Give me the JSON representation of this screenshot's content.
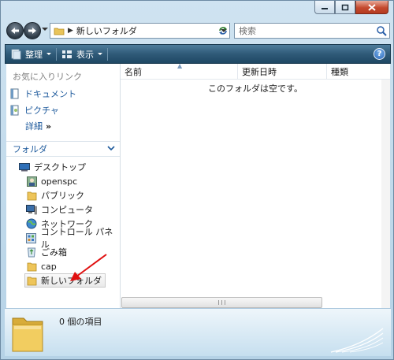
{
  "window": {
    "address_path": "新しいフォルダ",
    "search_placeholder": "検索"
  },
  "toolbar": {
    "organize_label": "整理",
    "views_label": "表示",
    "help_label": "?"
  },
  "nav": {
    "favorites_header": "お気に入りリンク",
    "favorites": [
      {
        "label": "ドキュメント",
        "icon": "documents-icon"
      },
      {
        "label": "ピクチャ",
        "icon": "pictures-icon"
      }
    ],
    "more_label": "詳細",
    "more_chevron": "»",
    "folders_header": "フォルダ",
    "tree": [
      {
        "label": "デスクトップ",
        "icon": "desktop-icon"
      },
      {
        "label": "openspc",
        "icon": "user-folder-icon"
      },
      {
        "label": "パブリック",
        "icon": "folder-icon"
      },
      {
        "label": "コンピュータ",
        "icon": "computer-icon"
      },
      {
        "label": "ネットワーク",
        "icon": "network-icon"
      },
      {
        "label": "コントロール パネル",
        "icon": "control-panel-icon"
      },
      {
        "label": "ごみ箱",
        "icon": "recycle-bin-icon"
      },
      {
        "label": "cap",
        "icon": "folder-icon"
      },
      {
        "label": "新しいフォルダ",
        "icon": "folder-icon",
        "selected": true
      }
    ]
  },
  "content": {
    "columns": [
      "名前",
      "更新日時",
      "種類"
    ],
    "empty_message": "このフォルダは空です。"
  },
  "details": {
    "item_count": "0 個の項目"
  },
  "colors": {
    "toolbar": "#2f5a78",
    "link": "#1e5a9c",
    "annotation_arrow": "#e01010"
  }
}
